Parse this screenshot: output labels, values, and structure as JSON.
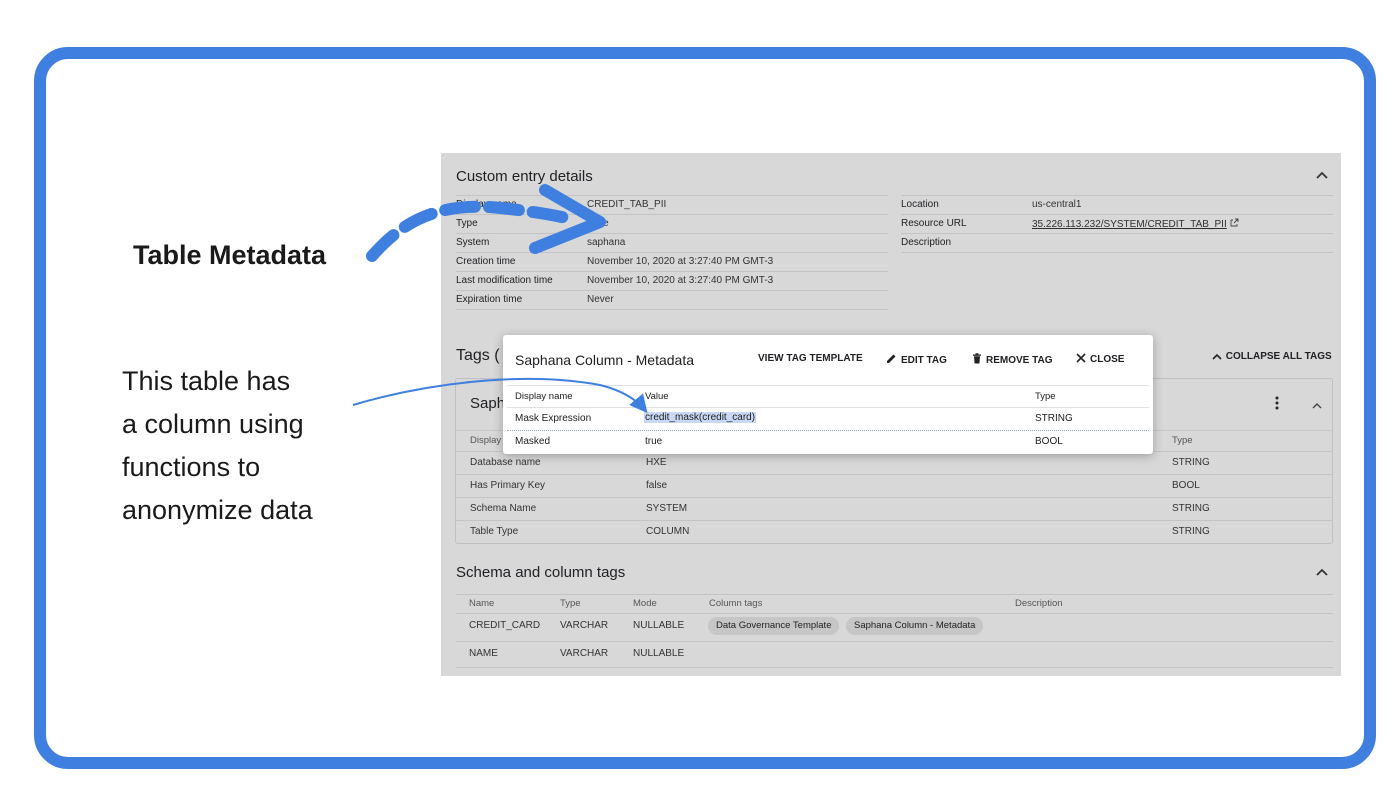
{
  "annotation": {
    "heading": "Table Metadata",
    "lines": [
      "This table has",
      "a column using",
      "functions to",
      "anonymize data"
    ]
  },
  "custom_entry": {
    "title": "Custom entry details",
    "left_rows": [
      {
        "label": "Display name",
        "value": "CREDIT_TAB_PII"
      },
      {
        "label": "Type",
        "value": "table"
      },
      {
        "label": "System",
        "value": "saphana"
      },
      {
        "label": "Creation time",
        "value": "November 10, 2020 at 3:27:40 PM GMT-3"
      },
      {
        "label": "Last modification time",
        "value": "November 10, 2020 at 3:27:40 PM GMT-3"
      },
      {
        "label": "Expiration time",
        "value": "Never"
      }
    ],
    "right_rows": [
      {
        "label": "Location",
        "value": "us-central1"
      },
      {
        "label": "Resource URL",
        "value": "35.226.113.232/SYSTEM/CREDIT_TAB_PII"
      },
      {
        "label": "Description",
        "value": ""
      }
    ]
  },
  "tags": {
    "title": "Tags (",
    "collapse_all": "COLLAPSE ALL TAGS",
    "card_title": "Saph",
    "headers": {
      "display": "Display",
      "type": "Type"
    },
    "rows": [
      {
        "name": "Database name",
        "value": "HXE",
        "type": "STRING"
      },
      {
        "name": "Has Primary Key",
        "value": "false",
        "type": "BOOL"
      },
      {
        "name": "Schema Name",
        "value": "SYSTEM",
        "type": "STRING"
      },
      {
        "name": "Table Type",
        "value": "COLUMN",
        "type": "STRING"
      }
    ]
  },
  "schema": {
    "title": "Schema and column tags",
    "headers": {
      "name": "Name",
      "type": "Type",
      "mode": "Mode",
      "column_tags": "Column tags",
      "description": "Description"
    },
    "rows": [
      {
        "name": "CREDIT_CARD",
        "type": "VARCHAR",
        "mode": "NULLABLE",
        "tags": [
          "Data Governance Template",
          "Saphana Column - Metadata"
        ]
      },
      {
        "name": "NAME",
        "type": "VARCHAR",
        "mode": "NULLABLE",
        "tags": []
      }
    ]
  },
  "modal": {
    "title": "Saphana Column - Metadata",
    "buttons": {
      "view_template": "VIEW TAG TEMPLATE",
      "edit": "EDIT TAG",
      "remove": "REMOVE TAG",
      "close": "CLOSE"
    },
    "headers": {
      "display": "Display name",
      "value": "Value",
      "type": "Type"
    },
    "rows": [
      {
        "display": "Mask Expression",
        "value": "credit_mask(credit_card)",
        "type": "STRING"
      },
      {
        "display": "Masked",
        "value": "true",
        "type": "BOOL"
      }
    ]
  },
  "colors": {
    "frame": "#3f7fe0",
    "arrow": "#3f7fe0",
    "highlight": "#c9d9f5"
  },
  "icons": [
    "chevron-up-icon",
    "external-link-icon",
    "more-vert-icon",
    "pencil-icon",
    "trash-icon",
    "close-icon"
  ]
}
